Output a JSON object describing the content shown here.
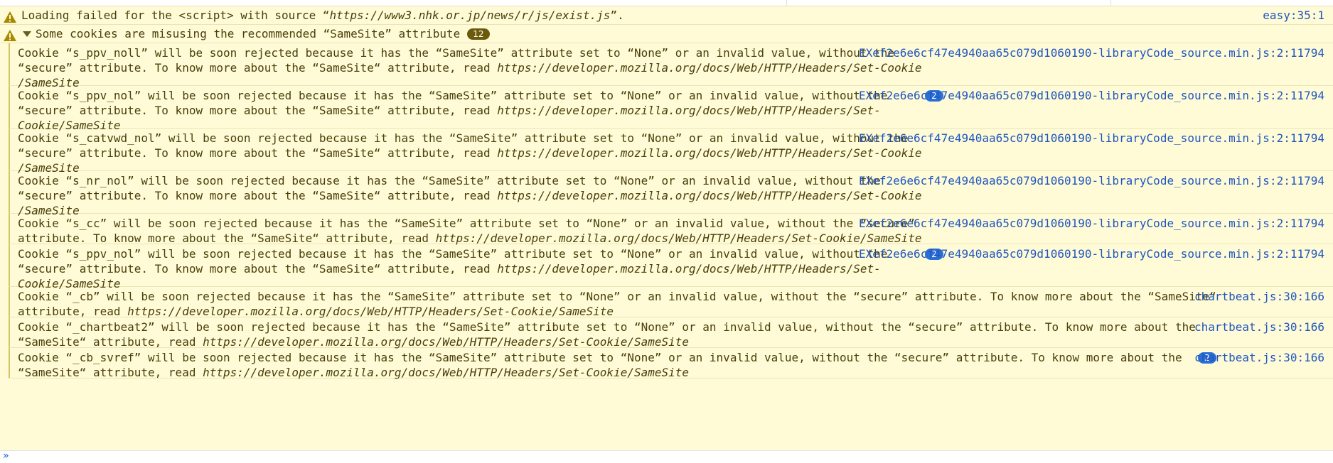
{
  "rows": [
    {
      "message": "Loading failed for the <script> with source “",
      "url": "https://www3.nhk.or.jp/news/r/js/exist.js",
      "message_tail": "”.",
      "source": "easy:35:1"
    }
  ],
  "group": {
    "title": "Some cookies are misusing the recommended “SameSite” attribute",
    "count": "12"
  },
  "messages": [
    {
      "line1": "Cookie “s_ppv_noll” will be soon rejected because it has the “SameSite” attribute set to “None” or an invalid value, without the",
      "line2_prefix": "“secure” attribute. To know more about the “SameSite“ attribute, read ",
      "line2_url": "https://developer.mozilla.org/docs/Web/HTTP/Headers/Set-Cookie",
      "line3_url": "/SameSite",
      "repeat": "",
      "source": "EXef2e6e6cf47e4940aa65c079d1060190-libraryCode_source.min.js:2:11794"
    },
    {
      "line1": "Cookie “s_ppv_nol” will be soon rejected because it has the “SameSite” attribute set to “None” or an invalid value, without the",
      "line2_prefix": "“secure” attribute. To know more about the “SameSite“ attribute, read ",
      "line2_url": "https://developer.mozilla.org/docs/Web/HTTP/Headers/Set-",
      "line3_url": "Cookie/SameSite",
      "repeat": "2",
      "source": "EXef2e6e6cf47e4940aa65c079d1060190-libraryCode_source.min.js:2:11794"
    },
    {
      "line1": "Cookie “s_catvwd_nol” will be soon rejected because it has the “SameSite” attribute set to “None” or an invalid value, without the",
      "line2_prefix": "“secure” attribute. To know more about the “SameSite“ attribute, read ",
      "line2_url": "https://developer.mozilla.org/docs/Web/HTTP/Headers/Set-Cookie",
      "line3_url": "/SameSite",
      "repeat": "",
      "source": "EXef2e6e6cf47e4940aa65c079d1060190-libraryCode_source.min.js:2:11794"
    },
    {
      "line1": "Cookie “s_nr_nol” will be soon rejected because it has the “SameSite” attribute set to “None” or an invalid value, without the",
      "line2_prefix": "“secure” attribute. To know more about the “SameSite“ attribute, read ",
      "line2_url": "https://developer.mozilla.org/docs/Web/HTTP/Headers/Set-Cookie",
      "line3_url": "/SameSite",
      "repeat": "",
      "source": "EXef2e6e6cf47e4940aa65c079d1060190-libraryCode_source.min.js:2:11794"
    },
    {
      "line1": "Cookie “s_cc” will be soon rejected because it has the “SameSite” attribute set to “None” or an invalid value, without the “secure”",
      "line2_prefix": "attribute. To know more about the “SameSite“ attribute, read ",
      "line2_url": "https://developer.mozilla.org/docs/Web/HTTP/Headers/Set-Cookie/SameSite",
      "line3_url": "",
      "repeat": "",
      "source": "EXef2e6e6cf47e4940aa65c079d1060190-libraryCode_source.min.js:2:11794"
    },
    {
      "line1": "Cookie “s_ppv_nol” will be soon rejected because it has the “SameSite” attribute set to “None” or an invalid value, without the",
      "line2_prefix": "“secure” attribute. To know more about the “SameSite“ attribute, read ",
      "line2_url": "https://developer.mozilla.org/docs/Web/HTTP/Headers/Set-",
      "line3_url": "Cookie/SameSite",
      "repeat": "2",
      "source": "EXef2e6e6cf47e4940aa65c079d1060190-libraryCode_source.min.js:2:11794"
    },
    {
      "line1": "Cookie “_cb” will be soon rejected because it has the “SameSite” attribute set to “None” or an invalid value, without the “secure” attribute. To know more about the “SameSite“",
      "line2_prefix": "attribute, read ",
      "line2_url": "https://developer.mozilla.org/docs/Web/HTTP/Headers/Set-Cookie/SameSite",
      "line3_url": "",
      "repeat": "",
      "source": "chartbeat.js:30:166"
    },
    {
      "line1": "Cookie “_chartbeat2” will be soon rejected because it has the “SameSite” attribute set to “None” or an invalid value, without the “secure” attribute. To know more about the",
      "line2_prefix": "“SameSite“ attribute, read ",
      "line2_url": "https://developer.mozilla.org/docs/Web/HTTP/Headers/Set-Cookie/SameSite",
      "line3_url": "",
      "repeat": "",
      "source": "chartbeat.js:30:166"
    },
    {
      "line1": "Cookie “_cb_svref” will be soon rejected because it has the “SameSite” attribute set to “None” or an invalid value, without the “secure” attribute. To know more about the",
      "line2_prefix": "“SameSite“ attribute, read ",
      "line2_url": "https://developer.mozilla.org/docs/Web/HTTP/Headers/Set-Cookie/SameSite",
      "line3_url": "",
      "repeat": "2",
      "source": "chartbeat.js:30:166"
    }
  ],
  "prompt_symbol": "»",
  "colors": {
    "warning_bg": "#fffbd6",
    "warning_text": "#4a3f0b",
    "link": "#1f56c1",
    "badge_blue": "#2a6fd6",
    "badge_brown": "#6b5a0b",
    "warning_icon": "#a88a00"
  }
}
